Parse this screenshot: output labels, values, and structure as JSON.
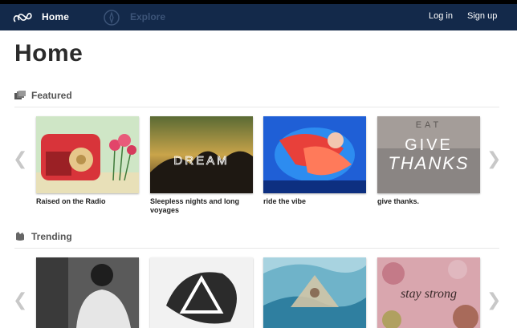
{
  "nav": {
    "home_label": "Home",
    "explore_label": "Explore",
    "login_label": "Log in",
    "signup_label": "Sign up"
  },
  "page": {
    "title": "Home"
  },
  "featured": {
    "label": "Featured",
    "items": [
      {
        "title": "Raised on the Radio"
      },
      {
        "title": "Sleepless nights and long voyages",
        "overlay": "DREAM"
      },
      {
        "title": "ride the vibe"
      },
      {
        "title": "give thanks.",
        "overlay_top": "EAT",
        "overlay_mid": "GIVE",
        "overlay_bottom": "THANKS"
      }
    ]
  },
  "trending": {
    "label": "Trending",
    "items": [
      {
        "title": ""
      },
      {
        "title": ""
      },
      {
        "title": ""
      },
      {
        "title": "",
        "overlay": "stay strong"
      }
    ]
  },
  "colors": {
    "navbar": "#13294a",
    "explore_muted": "#3c5478"
  }
}
